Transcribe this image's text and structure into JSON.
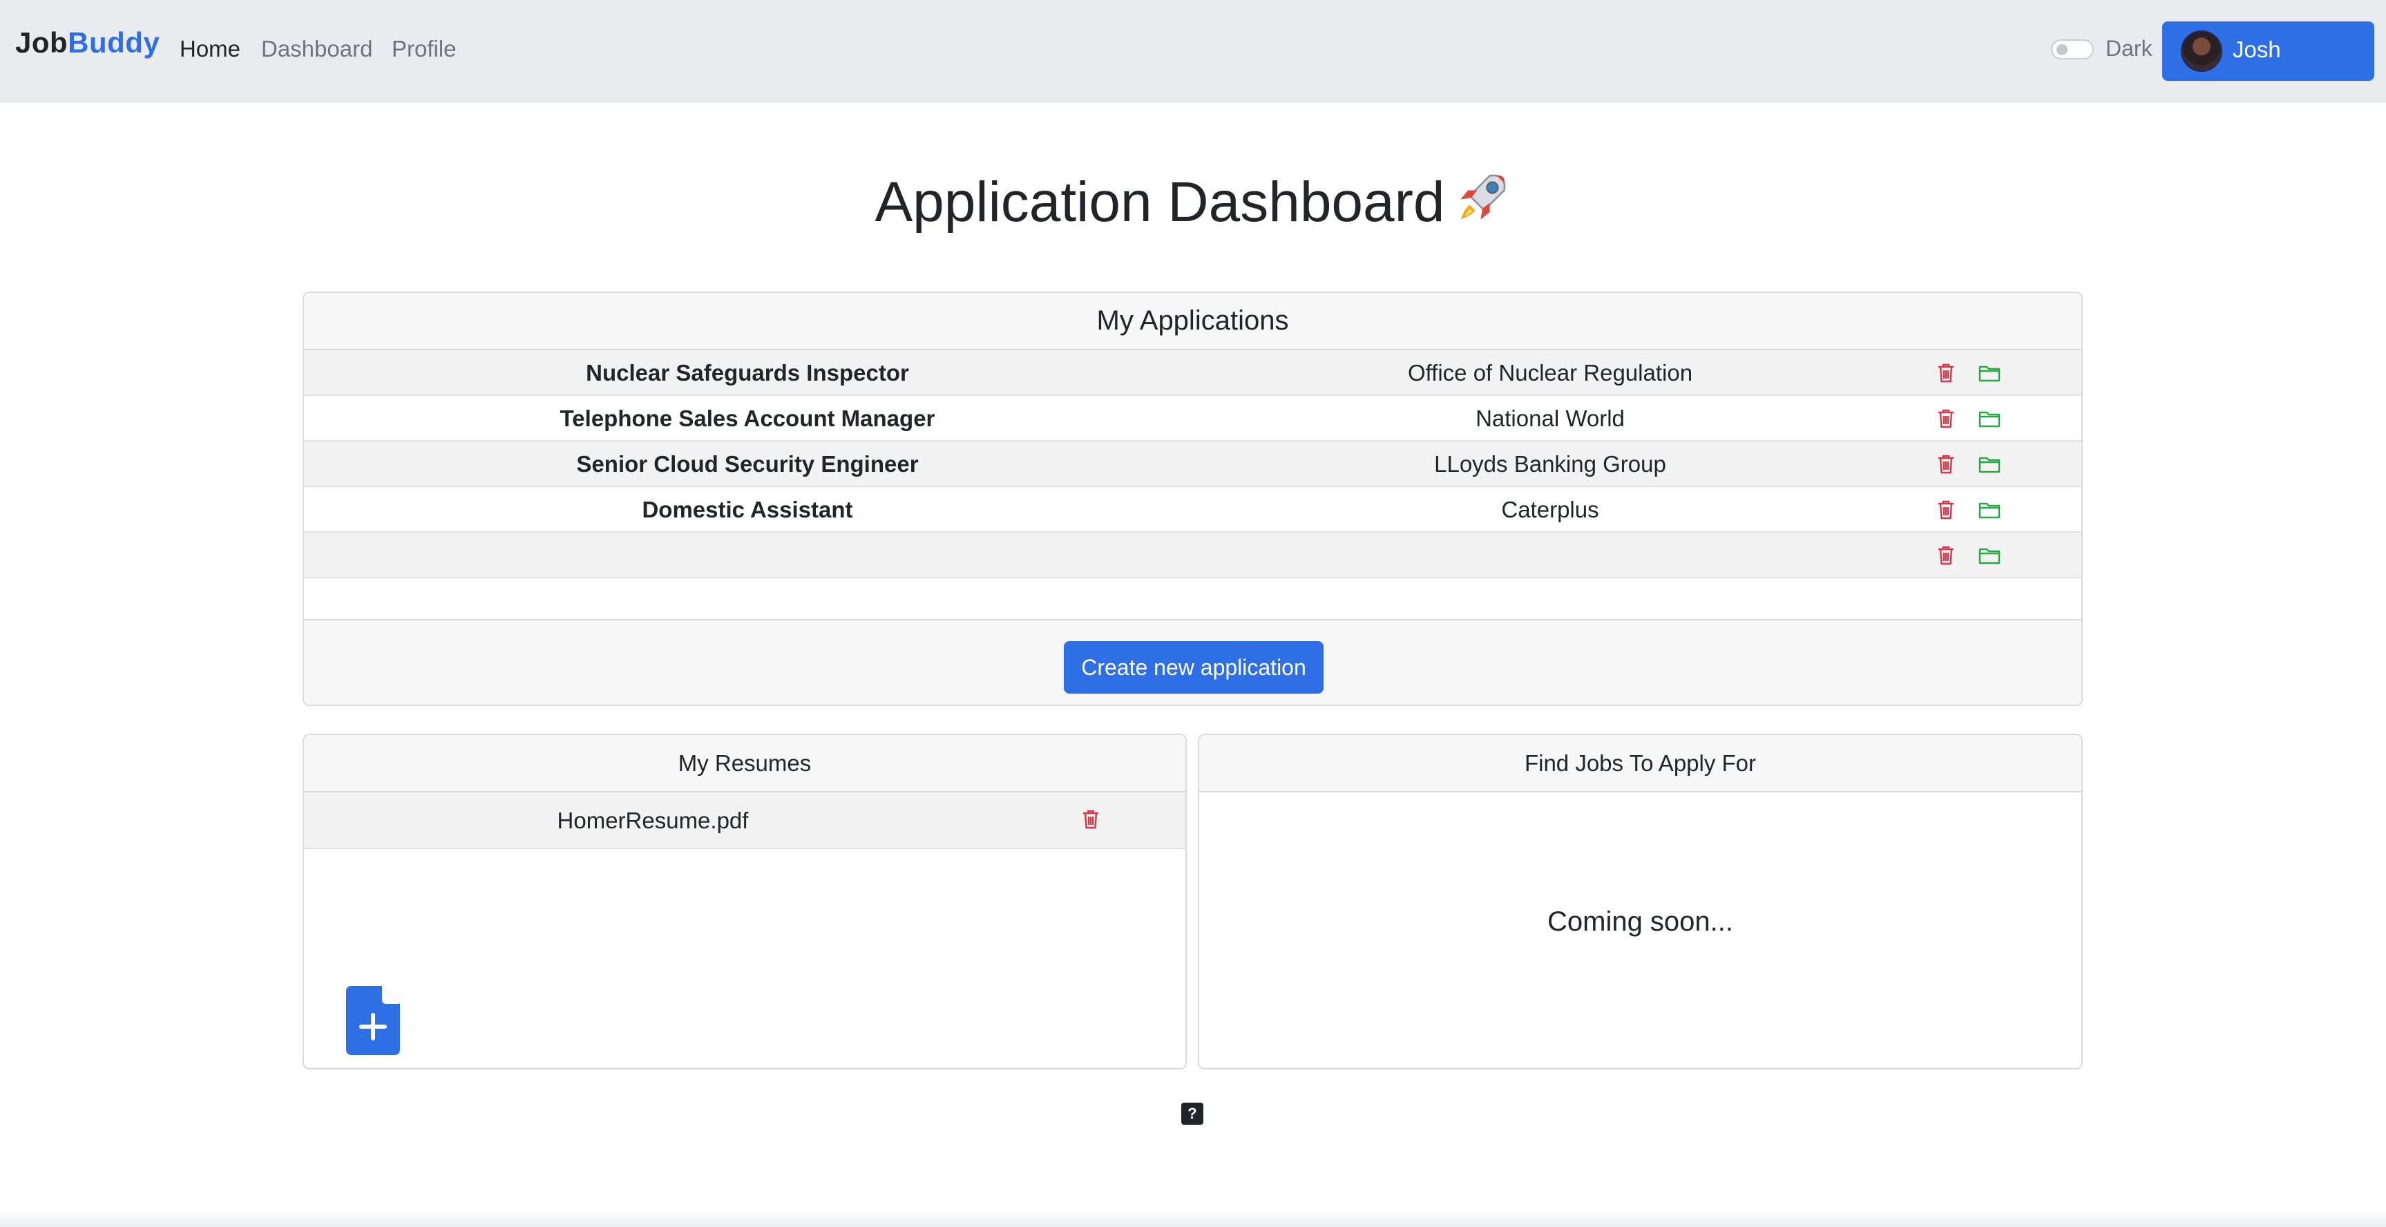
{
  "navbar": {
    "brand_part1": "Job",
    "brand_part2": "Buddy",
    "links": [
      {
        "label": "Home",
        "active": true
      },
      {
        "label": "Dashboard",
        "active": false
      },
      {
        "label": "Profile",
        "active": false
      }
    ],
    "dark_mode_label": "Dark",
    "dark_mode_on": false,
    "user_name": "Josh"
  },
  "page": {
    "title": "Application Dashboard"
  },
  "applications": {
    "header": "My Applications",
    "rows": [
      {
        "title": "Nuclear Safeguards Inspector",
        "company": "Office of Nuclear Regulation"
      },
      {
        "title": "Telephone Sales Account Manager",
        "company": "National World"
      },
      {
        "title": "Senior Cloud Security Engineer",
        "company": "LLoyds Banking Group"
      },
      {
        "title": "Domestic Assistant",
        "company": "Caterplus"
      },
      {
        "title": "",
        "company": ""
      }
    ],
    "create_button": "Create new application"
  },
  "resumes": {
    "header": "My Resumes",
    "items": [
      {
        "name": "HomerResume.pdf"
      }
    ]
  },
  "jobs": {
    "header": "Find Jobs To Apply For",
    "message": "Coming soon..."
  },
  "help": {
    "label": "?"
  },
  "colors": {
    "primary": "#2f6fe6",
    "danger": "#dc3545",
    "success": "#28a745",
    "navbar_bg": "#eaebef"
  }
}
